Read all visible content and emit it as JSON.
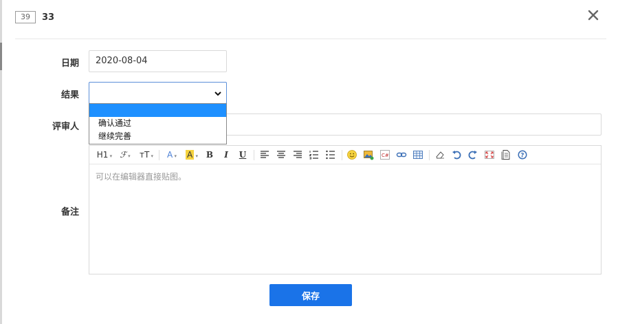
{
  "header": {
    "id_badge": "39",
    "title": "33",
    "close_icon": "close-icon"
  },
  "form": {
    "date": {
      "label": "日期",
      "value": "2020-08-04"
    },
    "result": {
      "label": "结果",
      "value": "",
      "options": [
        "",
        "确认通过",
        "继续完善"
      ],
      "selected_index": 0
    },
    "reviewer": {
      "label": "评审人",
      "value": ""
    },
    "remarks": {
      "label": "备注",
      "placeholder": "可以在编辑器直接贴图。"
    }
  },
  "editor_toolbar": {
    "heading": "H1",
    "font_family": "ℱ",
    "font_size": "тT",
    "font_color": "A",
    "bg_color": "A",
    "bold": "B",
    "italic": "I",
    "underline": "U",
    "colors": {
      "highlight": "#f6d33f",
      "font_color": "#4a7fd6",
      "accent": "#1a73e8"
    }
  },
  "actions": {
    "save_label": "保存"
  }
}
